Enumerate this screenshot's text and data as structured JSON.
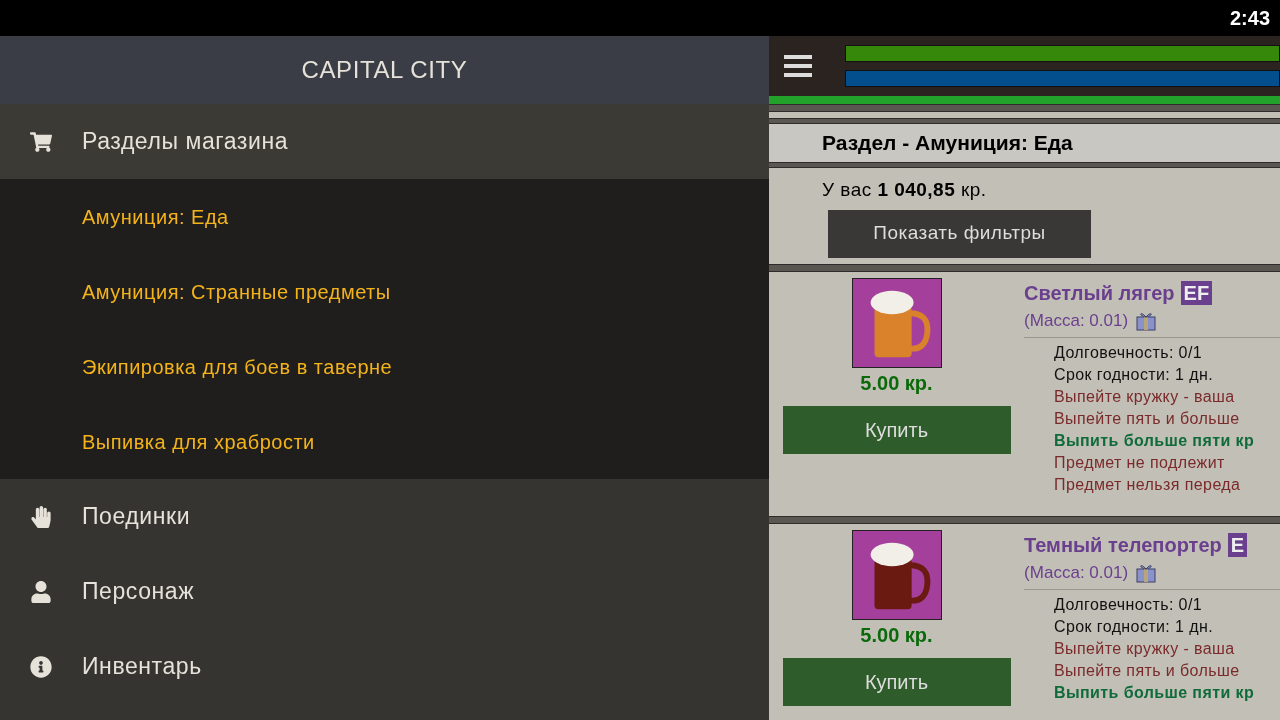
{
  "status_bar": {
    "time": "2:43"
  },
  "sidebar": {
    "title": "CAPITAL CITY",
    "items": [
      {
        "kind": "cart",
        "label": "Разделы магазина",
        "expanded": true,
        "children": [
          {
            "label": "Амуниция: Еда"
          },
          {
            "label": "Амуниция: Странные предметы"
          },
          {
            "label": "Экипировка для боев в таверне"
          },
          {
            "label": "Выпивка для храбрости"
          }
        ]
      },
      {
        "kind": "fist",
        "label": "Поединки"
      },
      {
        "kind": "user",
        "label": "Персонаж"
      },
      {
        "kind": "info",
        "label": "Инвентарь"
      }
    ]
  },
  "header": {
    "health": {
      "level": 1
    },
    "mana": {
      "level": 1
    }
  },
  "shop": {
    "title": "Раздел - Амуниция: Еда",
    "balance": "У вас **1 040,85** кр.",
    "filter_button": "Показать фильтры",
    "items": [
      {
        "name": "Светлый лягер",
        "badge": "EF",
        "mass": "(Масса: 0.01)",
        "price": "5.00 кр.",
        "buy": "Купить",
        "kind": "light",
        "lines": [
          {
            "kind": "plain",
            "text": "Долговечность: 0/1"
          },
          {
            "kind": "plain",
            "text": "Срок годности: 1 дн."
          },
          {
            "kind": "warn",
            "text": "Выпейте кружку - ваша"
          },
          {
            "kind": "warn",
            "text": "Выпейте пять и больше"
          },
          {
            "kind": "bonus",
            "text": "Выпить больше пяти кр"
          },
          {
            "kind": "warn",
            "text": "Предмет не подлежит"
          },
          {
            "kind": "warn",
            "text": "Предмет нельзя переда"
          }
        ]
      },
      {
        "name": "Темный телепортер",
        "badge": "E",
        "mass": "(Масса: 0.01)",
        "price": "5.00 кр.",
        "buy": "Купить",
        "kind": "dark",
        "lines": [
          {
            "kind": "plain",
            "text": "Долговечность: 0/1"
          },
          {
            "kind": "plain",
            "text": "Срок годности: 1 дн."
          },
          {
            "kind": "warn",
            "text": "Выпейте кружку - ваша"
          },
          {
            "kind": "warn",
            "text": "Выпейте пять и больше"
          },
          {
            "kind": "bonus",
            "text": "Выпить больше пяти кр"
          }
        ]
      }
    ]
  }
}
